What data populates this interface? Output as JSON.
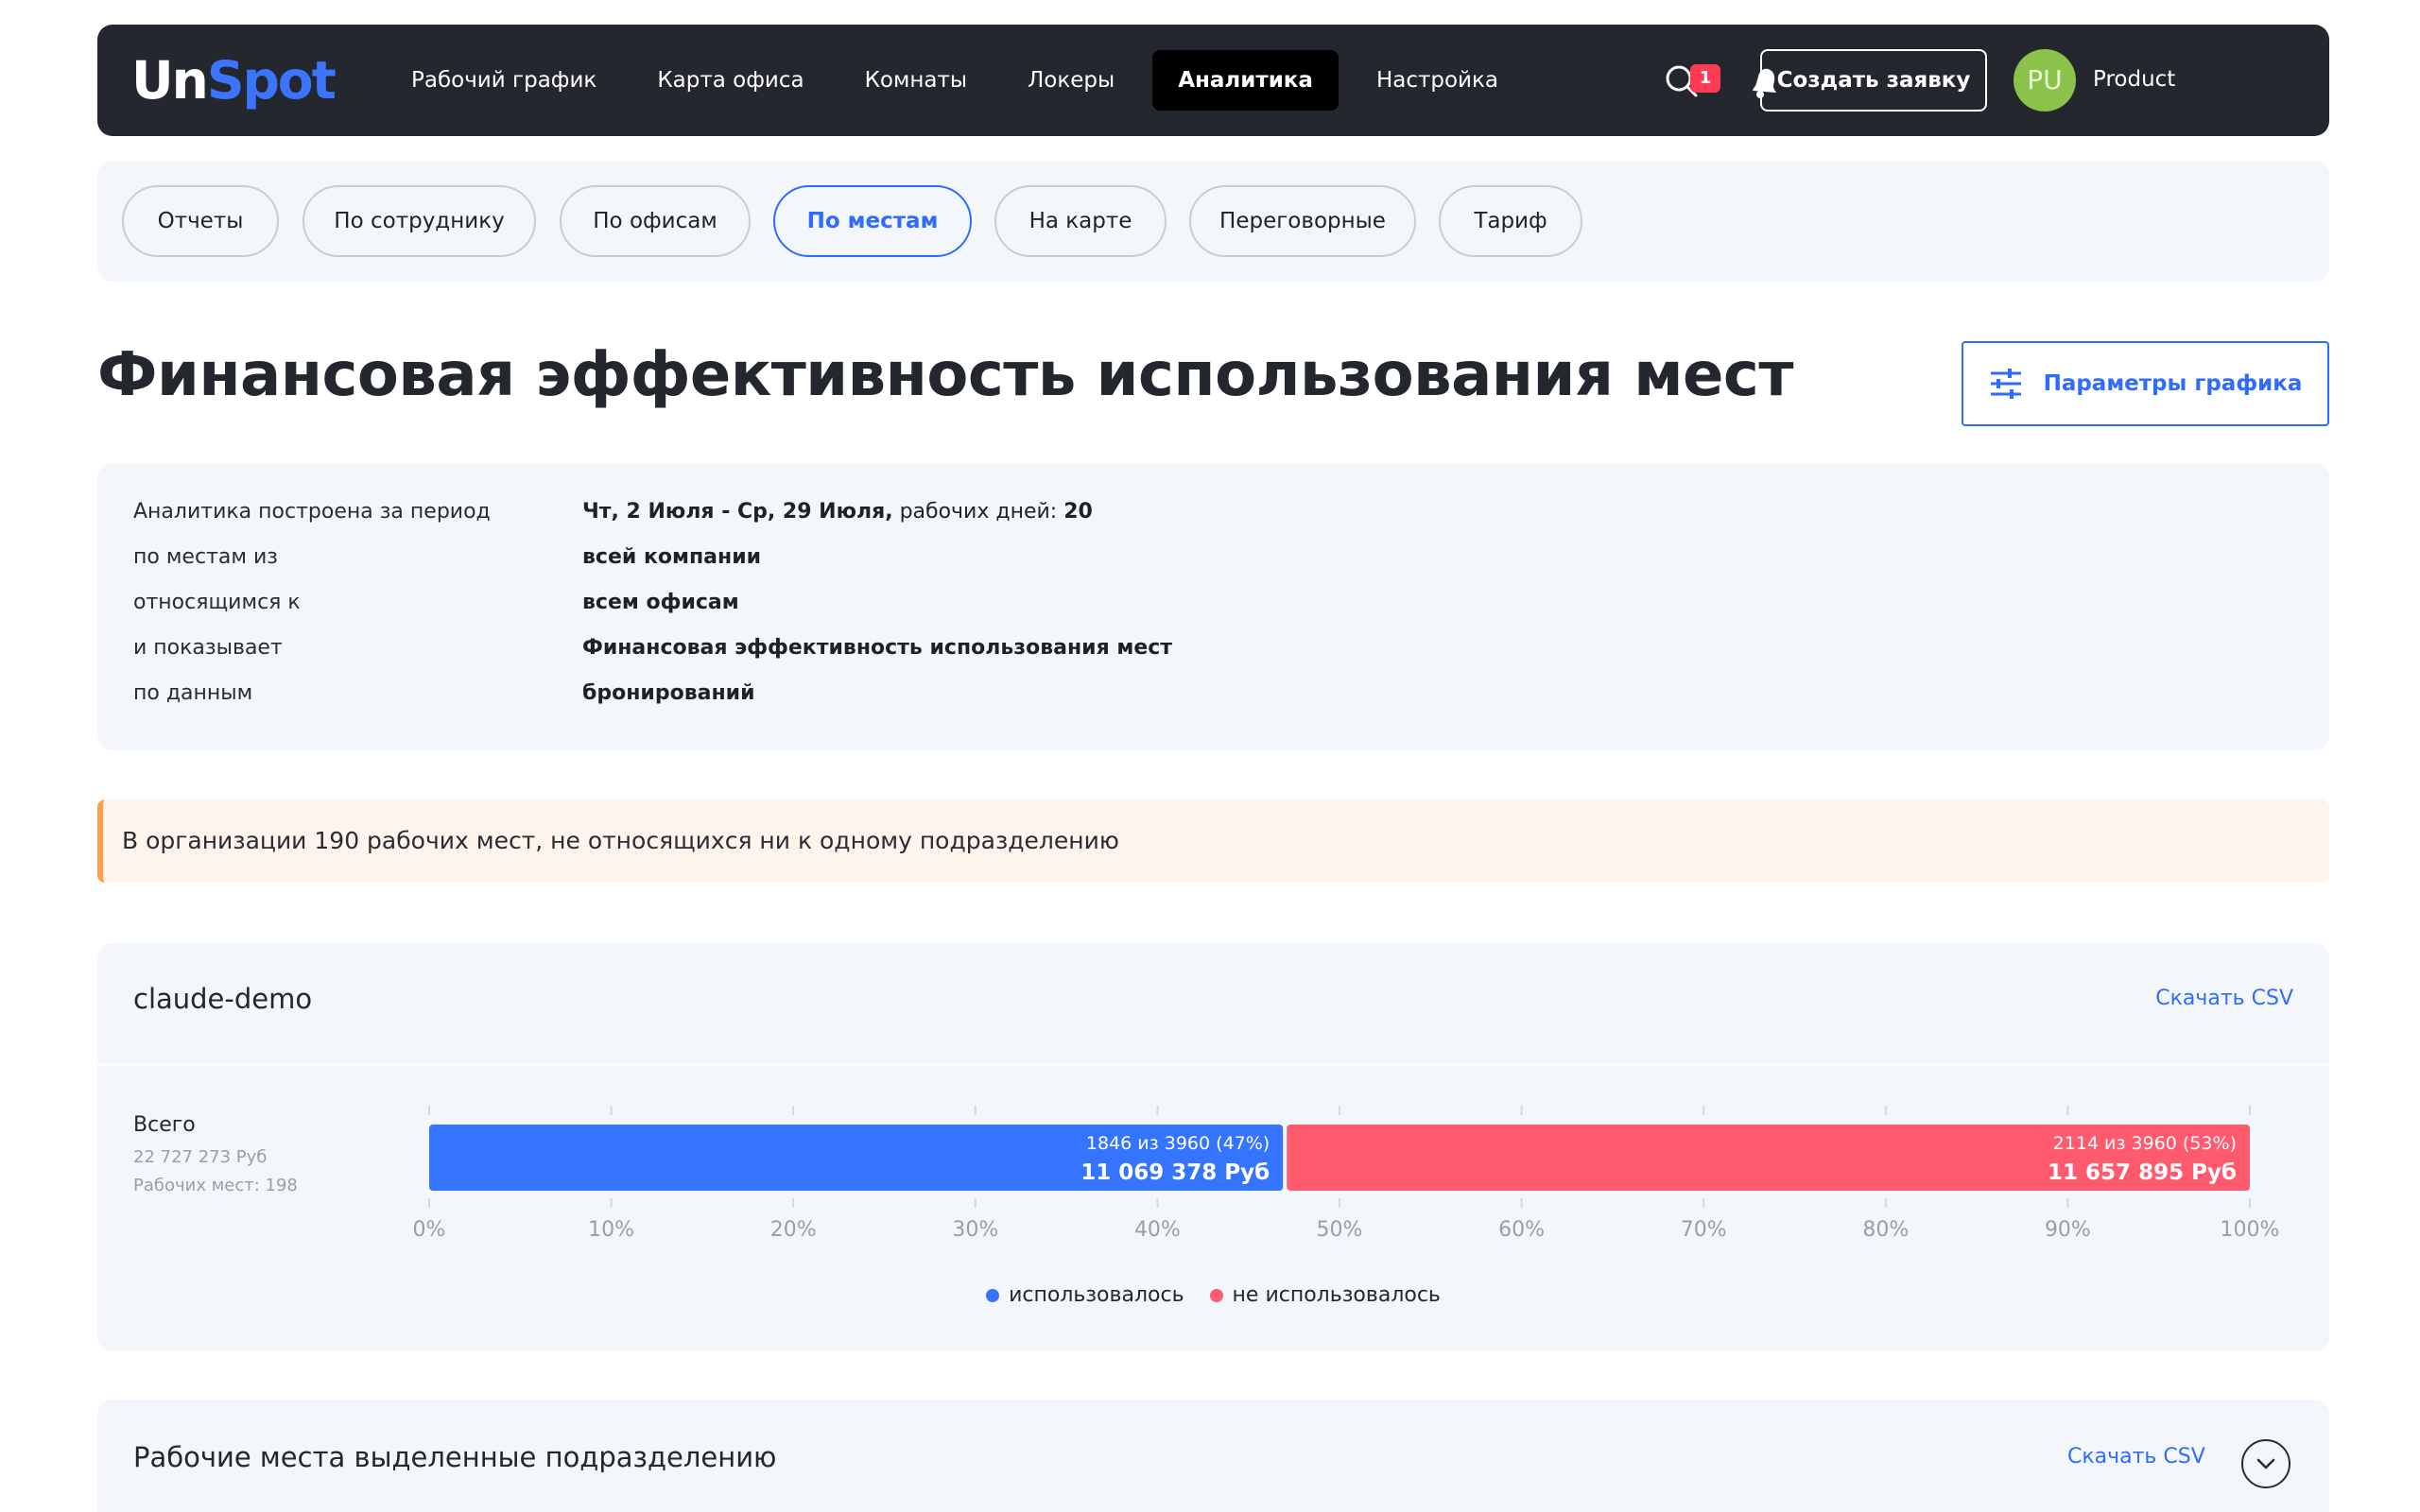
{
  "logo": {
    "part1": "Un",
    "part2": "Spot"
  },
  "nav": {
    "items": [
      {
        "label": "Рабочий график"
      },
      {
        "label": "Карта офиса"
      },
      {
        "label": "Комнаты"
      },
      {
        "label": "Локеры"
      },
      {
        "label": "Аналитика",
        "active": true
      },
      {
        "label": "Настройка"
      }
    ],
    "notifications_count": "1",
    "create_button": "Создать заявку",
    "avatar_initials": "PU",
    "user_name": "Product"
  },
  "subtabs": [
    {
      "label": "Отчеты"
    },
    {
      "label": "По сотруднику"
    },
    {
      "label": "По офисам"
    },
    {
      "label": "По местам",
      "active": true
    },
    {
      "label": "На карте"
    },
    {
      "label": "Переговорные"
    },
    {
      "label": "Тариф"
    }
  ],
  "page_title": "Финансовая эффективность использования мест",
  "params_button": "Параметры графика",
  "info": {
    "rows": [
      {
        "label": "Аналитика построена за период",
        "value": "Чт, 2 Июля - Ср, 29 Июля,",
        "value_extra": " рабочих дней: ",
        "value_extra_bold": "20"
      },
      {
        "label": "по местам из",
        "value": "всей компании"
      },
      {
        "label": "относящимся к",
        "value": "всем офисам"
      },
      {
        "label": "и показывает",
        "value": "Финансовая эффективность использования мест"
      },
      {
        "label": "по данным",
        "value": "бронирований"
      }
    ]
  },
  "warning": "В организации 190 рабочих мест, не относящихся ни к одному подразделению",
  "card": {
    "title": "claude-demo",
    "csv_link": "Скачать CSV",
    "row_label": "Всего",
    "row_total": "22 727 273 Руб",
    "row_seats": "Рабочих мест: 198"
  },
  "chart_data": {
    "type": "bar",
    "orientation": "horizontal-stacked",
    "categories": [
      "Всего"
    ],
    "series": [
      {
        "name": "использовалось",
        "values": [
          47
        ],
        "label_top": "1846 из 3960 (47%)",
        "label_bottom": "11 069 378 Руб",
        "color": "#3574ff"
      },
      {
        "name": "не использовалось",
        "values": [
          53
        ],
        "label_top": "2114 из 3960 (53%)",
        "label_bottom": "11 657 895 Руб",
        "color": "#ff5a6e"
      }
    ],
    "xlim": [
      0,
      100
    ],
    "x_ticks": [
      "0%",
      "10%",
      "20%",
      "30%",
      "40%",
      "50%",
      "60%",
      "70%",
      "80%",
      "90%",
      "100%"
    ],
    "legend_position": "bottom"
  },
  "card2": {
    "title": "Рабочие места выделенные подразделению",
    "csv_link": "Скачать CSV"
  },
  "colors": {
    "accent": "#2f6bff",
    "nav_bg": "#25272e",
    "used": "#3574ff",
    "unused": "#ff5a6e"
  }
}
